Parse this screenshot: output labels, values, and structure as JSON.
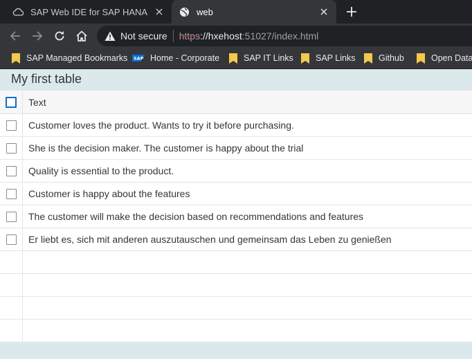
{
  "browser": {
    "tabs": [
      {
        "title": "SAP Web IDE for SAP HANA",
        "active": false,
        "icon": "cloud-icon"
      },
      {
        "title": "web",
        "active": true,
        "icon": "globe-icon"
      }
    ],
    "security_label": "Not secure",
    "url": {
      "scheme": "https",
      "host": "://hxehost",
      "rest": ":51027/index.html"
    },
    "bookmarks": [
      {
        "label": "SAP Managed Bookmarks",
        "icon": "folder-icon"
      },
      {
        "label": "Home - Corporate",
        "icon": "sap-logo-icon"
      },
      {
        "label": "SAP IT Links",
        "icon": "folder-icon"
      },
      {
        "label": "SAP Links",
        "icon": "folder-icon"
      },
      {
        "label": "Github",
        "icon": "folder-icon"
      },
      {
        "label": "Open Data",
        "icon": "folder-icon"
      }
    ],
    "sap_logo_text": "SAP"
  },
  "page": {
    "title": "My first table",
    "table": {
      "header": "Text",
      "rows": [
        "Customer loves the product. Wants to try it before purchasing.",
        "She is the decision maker. The customer is happy about the trial",
        "Quality is essential to the product.",
        "Customer is happy about the features",
        "The customer will make the decision based on recommendations and features",
        "Er liebt es, sich mit anderen auszutauschen und gemeinsam das Leben zu genießen"
      ],
      "empty_rows": 4
    }
  },
  "colors": {
    "tab_strip": "#202124",
    "toolbar": "#35363a",
    "page_bg": "#dbe9ed",
    "accent": "#0a6ed1",
    "folder": "#f2c94c"
  }
}
